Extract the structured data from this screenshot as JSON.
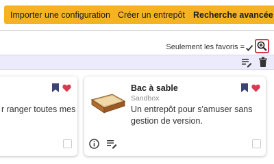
{
  "toolbar": {
    "import_label": "Importer une configuration",
    "create_label": "Créer un entrepôt",
    "search_label": "Recherche avancée"
  },
  "filters": {
    "favorites_label": "Seulement les favoris ="
  },
  "cards": [
    {
      "description_fragment": "r ranger toutes mes"
    },
    {
      "title": "Bac à sable",
      "subtitle": "Sandbox",
      "description": "Un entrepôt pour s'amuser sans gestion de version."
    }
  ],
  "colors": {
    "accent_button": "#f5b324",
    "highlight_border": "#d9384e",
    "bookmark": "#3d4373",
    "heart": "#d93a4f",
    "band": "#ecebfb"
  },
  "icons": [
    "checkmark-icon",
    "zoom-in-icon",
    "list-edit-icon",
    "trash-icon",
    "bookmark-icon",
    "heart-icon",
    "info-icon",
    "document-list-icon"
  ]
}
